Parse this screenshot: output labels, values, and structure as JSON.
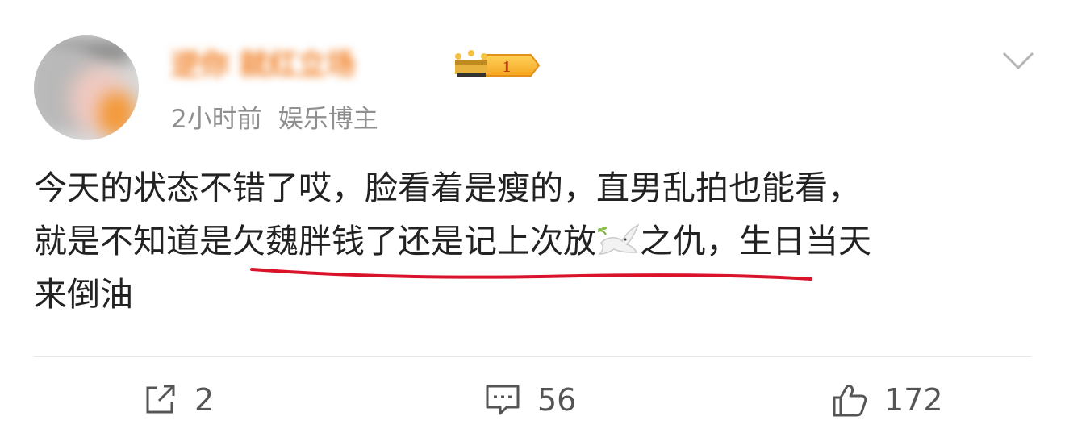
{
  "post": {
    "author": {
      "name": "逆你  就红立场",
      "avatar_icon": "avatar-photo-blurred",
      "badge_icon": "crown-level-badge",
      "badge_level": "1"
    },
    "time": "2小时前",
    "role": "娱乐博主",
    "menu_icon": "chevron-down-icon",
    "content": {
      "line1": "今天的状态不错了哎，脸看着是瘦的，直男乱拍也能看，",
      "line2_a": "就是不知道是欠魏胖钱了还是记上次放",
      "emoji": "dove-emoji",
      "line2_b": "之仇，生日当天",
      "line3": "来倒油"
    },
    "highlight_color": "#d9142a",
    "username_color": "#f07d22"
  },
  "actions": {
    "repost_count": "2",
    "comment_count": "56",
    "like_count": "172",
    "repost_icon": "repost-icon",
    "comment_icon": "comment-icon",
    "like_icon": "thumbs-up-icon"
  }
}
